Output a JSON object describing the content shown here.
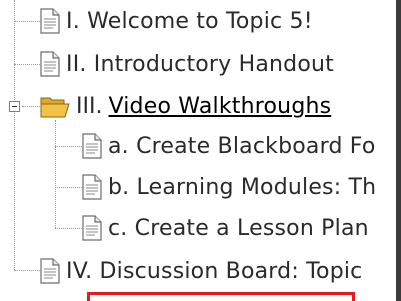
{
  "tree": {
    "items": [
      {
        "label": "I. Welcome to Topic 5!",
        "icon": "document-icon"
      },
      {
        "label": "II. Introductory Handout",
        "icon": "document-icon"
      },
      {
        "prefix": "III.",
        "label": "Video Walkthroughs",
        "icon": "open-folder-icon",
        "expanded": true
      },
      {
        "label": "a. Create Blackboard Fo",
        "icon": "document-icon"
      },
      {
        "label": "b. Learning Modules: Th",
        "icon": "document-icon"
      },
      {
        "label": "c. Create a Lesson Plan",
        "icon": "document-icon"
      },
      {
        "label": "IV. Discussion Board: Topic",
        "icon": "document-icon"
      }
    ]
  },
  "colors": {
    "highlight_border": "#e41b1b",
    "folder": "#f2c14a",
    "tree_line": "#9a9a9a"
  }
}
